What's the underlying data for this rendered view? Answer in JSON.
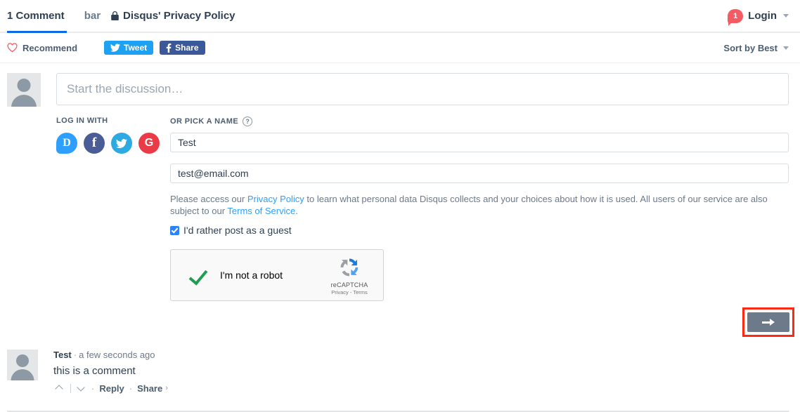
{
  "header": {
    "comment_tab": "1 Comment",
    "site_tab": "bar",
    "privacy_policy": "Disqus' Privacy Policy",
    "lock_icon": "lock-icon",
    "login_count": "1",
    "login_label": "Login"
  },
  "actions": {
    "recommend": "Recommend",
    "heart_icon": "heart-icon",
    "tweet": "Tweet",
    "twitter_icon": "twitter-icon",
    "share": "Share",
    "facebook_icon": "facebook-icon",
    "sort": "Sort by Best"
  },
  "composer": {
    "avatar_icon": "user-avatar-placeholder",
    "placeholder": "Start the discussion…",
    "login_with_label": "LOG IN WITH",
    "social": [
      {
        "name": "Disqus",
        "glyph": "D",
        "color": "#2e9fff"
      },
      {
        "name": "Facebook",
        "glyph": "f",
        "color": "#4a5d96"
      },
      {
        "name": "Twitter",
        "glyph": "",
        "color": "#2caae1"
      },
      {
        "name": "Google",
        "glyph": "G",
        "color": "#eb3b46"
      }
    ],
    "pick_name_label": "OR PICK A NAME",
    "help_glyph": "?",
    "name_value": "Test",
    "email_value": "test@email.com",
    "legal": {
      "part1": "Please access our ",
      "link1": "Privacy Policy",
      "part2": " to learn what personal data Disqus collects and your choices about how it is used. All users of our service are also subject to our ",
      "link2": "Terms of Service",
      "part3": "."
    },
    "guest_checkbox_label": "I'd rather post as a guest",
    "guest_checked": true
  },
  "recaptcha": {
    "label": "I'm not a robot",
    "checked": true,
    "brand": "reCAPTCHA",
    "terms": "Privacy - Terms"
  },
  "submit": {
    "arrow_icon": "arrow-right-icon",
    "highlight_color": "#fd2a12",
    "button_color": "#6c7a89"
  },
  "comment": {
    "avatar_icon": "user-avatar-placeholder",
    "author": "Test",
    "time": "a few seconds ago",
    "text": "this is a comment",
    "upvote_icon": "chevron-up-icon",
    "downvote_icon": "chevron-down-icon",
    "reply": "Reply",
    "share": "Share",
    "share_caret": "›",
    "dot": "·"
  }
}
